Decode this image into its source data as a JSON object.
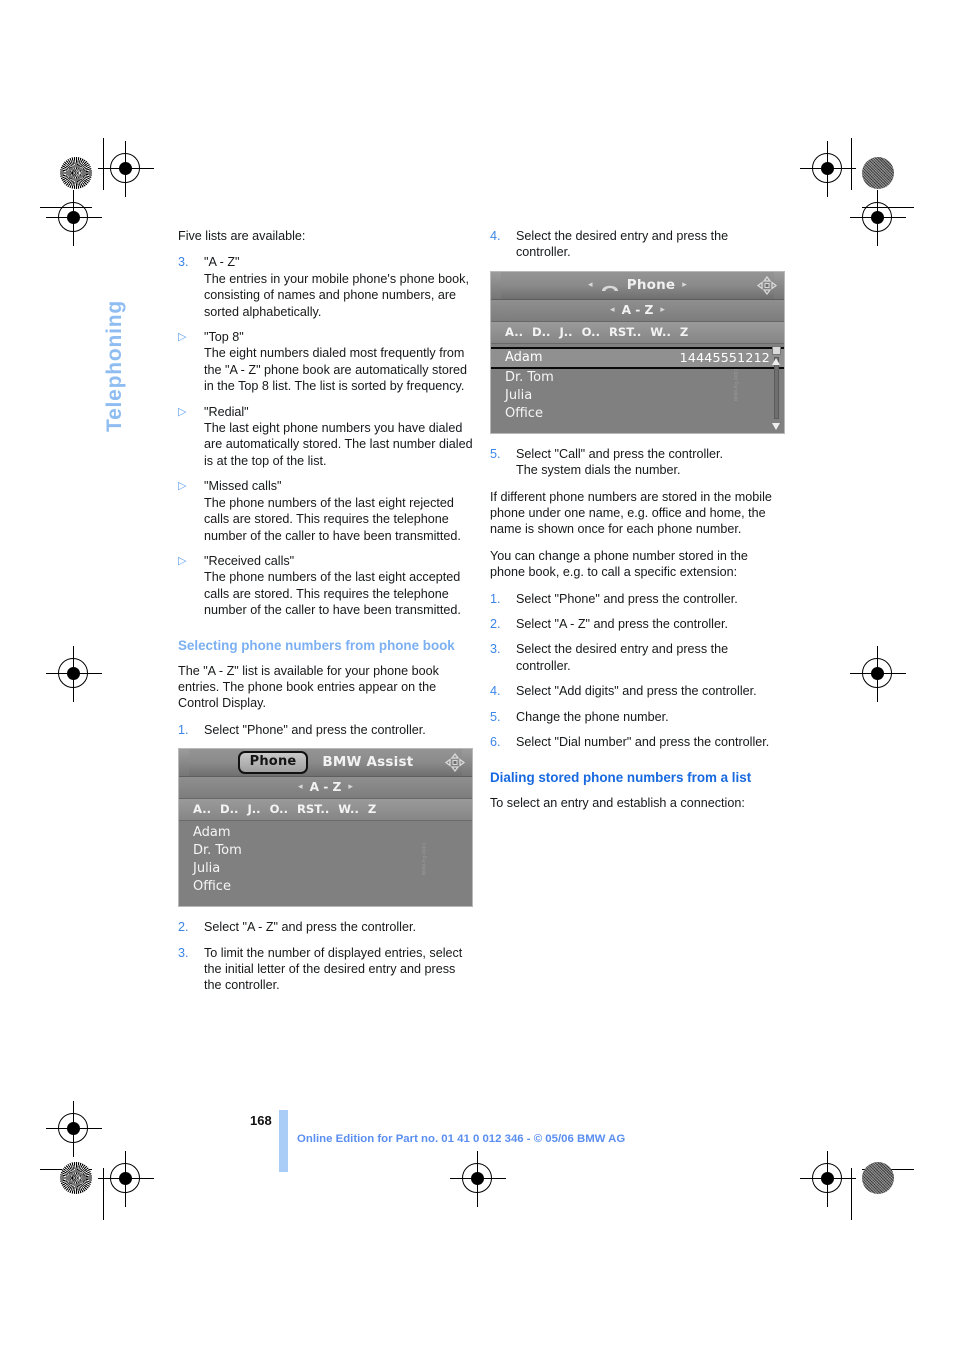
{
  "page": {
    "chapter_tab": "Telephoning",
    "page_number": "168",
    "footer_text": "Online Edition for Part no. 01 41 0 012 346 - © 05/06 BMW AG"
  },
  "left_column": {
    "intro": "Five lists are available:",
    "list_items": [
      {
        "marker": "3.",
        "marker_type": "number",
        "title": "\"A - Z\"",
        "body": "The entries in your mobile phone's phone book, consisting of names and phone numbers, are sorted alphabetically."
      },
      {
        "marker": "▷",
        "marker_type": "triangle",
        "title": "\"Top 8\"",
        "body": "The eight numbers dialed most frequently from the \"A - Z\" phone book are automatically stored in the Top 8 list. The list is sorted by frequency."
      },
      {
        "marker": "▷",
        "marker_type": "triangle",
        "title": "\"Redial\"",
        "body": "The last eight phone numbers you have dialed are automatically stored. The last number dialed is at the top of the list."
      },
      {
        "marker": "▷",
        "marker_type": "triangle",
        "title": "\"Missed calls\"",
        "body": "The phone numbers of the last eight rejected calls are stored. This requires the telephone number of the caller to have been transmitted."
      },
      {
        "marker": "▷",
        "marker_type": "triangle",
        "title": "\"Received calls\"",
        "body": "The phone numbers of the last eight accepted calls are stored. This requires the telephone number of the caller to have been transmitted."
      }
    ],
    "heading": "Selecting phone numbers from phone book",
    "heading_paragraph": "The \"A - Z\" list is available for your phone book entries. The phone book entries appear on the Control Display.",
    "steps_before_screen": [
      {
        "marker": "1.",
        "text": "Select \"Phone\" and press the controller."
      }
    ],
    "steps_after_screen": [
      {
        "marker": "2.",
        "text": "Select \"A - Z\" and press the controller."
      },
      {
        "marker": "3.",
        "text": "To limit the number of displayed entries, select the initial letter of the desired entry and press the controller."
      }
    ]
  },
  "right_column": {
    "steps_before_screen": [
      {
        "marker": "4.",
        "text": "Select the desired entry and press the controller."
      }
    ],
    "step_after_screen": {
      "marker": "5.",
      "line1": "Select \"Call\" and press the controller.",
      "line2": "The system dials the number."
    },
    "paragraph_1": "If different phone numbers are stored in the mobile phone under one name, e.g. office and home, the name is shown once for each phone number.",
    "paragraph_2": "You can change a phone number stored in the phone book, e.g. to call a specific extension:",
    "change_steps": [
      {
        "marker": "1.",
        "text": "Select \"Phone\" and press the controller."
      },
      {
        "marker": "2.",
        "text": "Select \"A - Z\" and press the controller."
      },
      {
        "marker": "3.",
        "text": "Select the desired entry and press the controller."
      },
      {
        "marker": "4.",
        "text": "Select \"Add digits\" and press the controller."
      },
      {
        "marker": "5.",
        "text": "Change the phone number."
      },
      {
        "marker": "6.",
        "text": "Select \"Dial number\" and press the controller."
      }
    ],
    "heading": "Dialing stored phone numbers from a list",
    "heading_paragraph": "To select an entry and establish a connection:"
  },
  "screen_left": {
    "titlebar": {
      "active_tab": "Phone",
      "inactive_tab": "BMW Assist",
      "joystick_icon": "controller-icon"
    },
    "subbar": {
      "left_arrow": "◂",
      "label": "A - Z",
      "right_arrow": "▸"
    },
    "letterbar": [
      "A..",
      "D..",
      "J..",
      "O..",
      "RST..",
      "W..",
      "Z"
    ],
    "rows": [
      {
        "name": "Adam",
        "number": ""
      },
      {
        "name": "Dr. Tom",
        "number": ""
      },
      {
        "name": "Julia",
        "number": ""
      },
      {
        "name": "Office",
        "number": ""
      }
    ],
    "side_code": "BMW-Fig-0001"
  },
  "screen_right": {
    "titlebar": {
      "left_arrow": "◂",
      "handset_icon": "handset-icon",
      "label": "Phone",
      "right_arrow": "▸",
      "joystick_icon": "controller-icon"
    },
    "subbar": {
      "left_arrow": "◂",
      "label": "A - Z",
      "right_arrow": "▸"
    },
    "letterbar": [
      "A..",
      "D..",
      "J..",
      "O..",
      "RST..",
      "W..",
      "Z"
    ],
    "rows": [
      {
        "name": "Adam",
        "number": "14445551212",
        "selected": true
      },
      {
        "name": "Dr. Tom",
        "number": "",
        "selected": false
      },
      {
        "name": "Julia",
        "number": "",
        "selected": false
      },
      {
        "name": "Office",
        "number": "",
        "selected": false
      }
    ],
    "side_code": "BMW-Fig-0002"
  },
  "colors": {
    "accent_light_blue": "#7cb0f2",
    "accent_blue": "#1769e0",
    "marker_blue": "#3b86e8",
    "tab_blue": "#8fbdf2",
    "footer_blue": "#5a8ef0"
  }
}
